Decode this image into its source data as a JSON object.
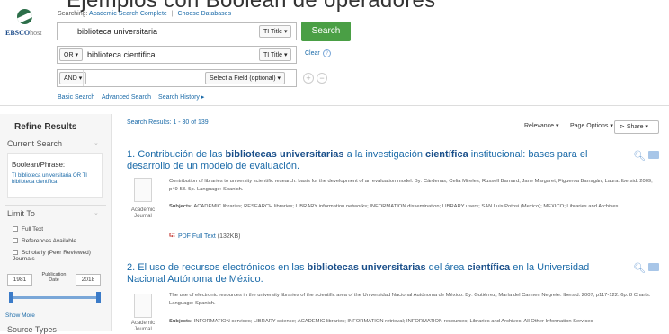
{
  "page_title": "Ejemplos con Boolean de operadores",
  "logo": {
    "brand": "EBSCO",
    "suffix": "host"
  },
  "search_header": {
    "searching_label": "Searching:",
    "database": "Academic Search Complete",
    "choose": "Choose Databases"
  },
  "rows": [
    {
      "value": "biblioteca universitaria",
      "field": "TI Title ▾"
    },
    {
      "operator": "OR ▾",
      "value": "biblioteca cientifica",
      "field": "TI Title ▾"
    },
    {
      "operator": "AND ▾",
      "value": "",
      "field": "Select a Field (optional) ▾"
    }
  ],
  "search_button": "Search",
  "clear": "Clear",
  "help": "?",
  "add_row": "+",
  "remove_row": "−",
  "links": [
    "Basic Search",
    "Advanced Search",
    "Search History ▸"
  ],
  "sidebar": {
    "title": "Refine Results",
    "current_search": "Current Search",
    "boolean_label": "Boolean/Phrase:",
    "boolean_value": "TI biblioteca universitaria OR TI biblioteca cientifica",
    "limit_to": "Limit To",
    "limits": [
      "Full Text",
      "References Available",
      "Scholarly (Peer Reviewed) Journals"
    ],
    "pub_date_from": "1981",
    "pub_date_label": "Publication Date",
    "pub_date_to": "2018",
    "show_more": "Show More",
    "source_types": "Source Types"
  },
  "results_header": "Search Results: 1 - 30 of 139",
  "sort": {
    "relevance": "Relevance ▾",
    "page_options": "Page Options ▾",
    "share": "Share ▾"
  },
  "results": [
    {
      "title_parts": [
        "1. Contribución de las ",
        "bibliotecas universitarias",
        " a la investigación ",
        "científica",
        " institucional: bases para el desarrollo de un modelo de evaluación."
      ],
      "meta": "Contribution of libraries to university scientific research: basis for the development of an evaluation model. By: Cárdenas, Celia Mireles; Russell Barnard, Jane Margaret; Figueroa Barragán, Laura. Ibersid. 2009, p49-53. 5p. Language: Spanish.",
      "subjects_label": "Subjects:",
      "subjects": " ACADEMIC libraries; RESEARCH libraries; LIBRARY information networks; INFORMATION dissemination; LIBRARY users; SAN Luis Potosi (Mexico); MEXICO; Libraries and Archives",
      "type": "Academic Journal",
      "pdf": "PDF Full Text",
      "pdf_size": "(132KB)"
    },
    {
      "title_parts": [
        "2. El uso de recursos electrónicos en las ",
        "bibliotecas universitarias",
        " del área ",
        "científica",
        " en la Universidad Nacional Autónoma de México."
      ],
      "meta": "The use of electronic resources in the university libraries of the scientific area of the Universidad Nacional Autónoma de México. By: Gutiérrez, María del Carmen Negrete. Ibersid. 2007, p117-122. 6p. 8 Charts. Language: Spanish.",
      "subjects_label": "Subjects:",
      "subjects": " INFORMATION services; LIBRARY science; ACADEMIC libraries; INFORMATION retrieval; INFORMATION resources; Libraries and Archives; All Other Information Services",
      "type": "Academic Journal"
    }
  ]
}
